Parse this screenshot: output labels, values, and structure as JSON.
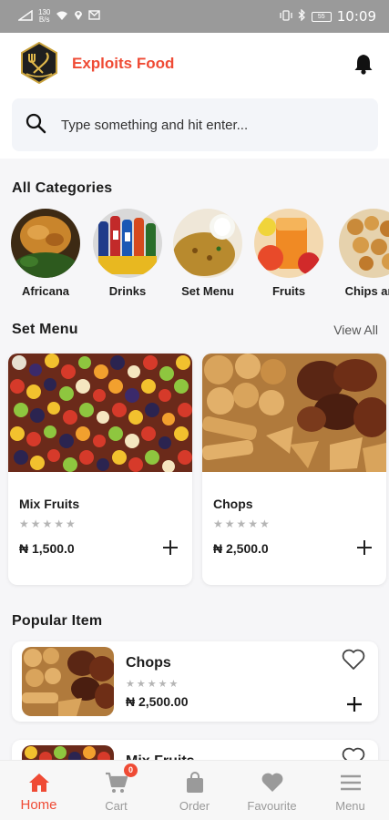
{
  "status_bar": {
    "speed_top": "130",
    "speed_bottom": "B/s",
    "battery": "55",
    "time": "10:09"
  },
  "header": {
    "brand": "Exploits Food",
    "logo_icon": "restaurant-logo-icon",
    "notification_icon": "bell-icon"
  },
  "search": {
    "placeholder": "Type something and hit enter..."
  },
  "categories": {
    "title": "All Categories",
    "items": [
      {
        "label": "Africana"
      },
      {
        "label": "Drinks"
      },
      {
        "label": "Set Menu"
      },
      {
        "label": "Fruits"
      },
      {
        "label": "Chips and"
      }
    ]
  },
  "set_menu": {
    "title": "Set Menu",
    "view_all": "View All",
    "items": [
      {
        "name": "Mix Fruits",
        "stars": "★★★★★",
        "rating": 0,
        "price": "₦ 1,500.0"
      },
      {
        "name": "Chops",
        "stars": "★★★★★",
        "rating": 0,
        "price": "₦ 2,500.0"
      }
    ]
  },
  "popular": {
    "title": "Popular Item",
    "items": [
      {
        "name": "Chops",
        "stars": "★★★★★",
        "rating": 0,
        "price": "₦ 2,500.00"
      },
      {
        "name": "Mix Fruits"
      }
    ]
  },
  "bottom_nav": {
    "items": [
      {
        "label": "Home",
        "icon": "home-icon"
      },
      {
        "label": "Cart",
        "icon": "cart-icon",
        "badge": "0"
      },
      {
        "label": "Order",
        "icon": "bag-icon"
      },
      {
        "label": "Favourite",
        "icon": "heart-icon"
      },
      {
        "label": "Menu",
        "icon": "menu-icon"
      }
    ]
  },
  "colors": {
    "accent": "#ef4b35",
    "background": "#f6f6f8",
    "status_bar": "#9a9a9a",
    "inactive": "#9a9a9a"
  }
}
